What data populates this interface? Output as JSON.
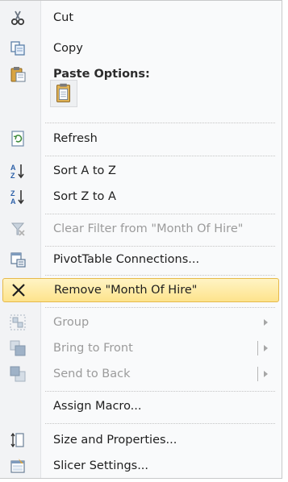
{
  "menu": {
    "cut": "Cut",
    "copy": "Copy",
    "paste_options": "Paste Options:",
    "refresh": "Refresh",
    "sort_az": "Sort A to Z",
    "sort_za": "Sort Z to A",
    "clear_filter": "Clear Filter from \"Month Of Hire\"",
    "pivot_connections": "PivotTable Connections...",
    "remove": "Remove \"Month Of Hire\"",
    "group": "Group",
    "bring_to_front": "Bring to Front",
    "send_to_back": "Send to Back",
    "assign_macro": "Assign Macro...",
    "size_properties": "Size and Properties...",
    "slicer_settings": "Slicer Settings..."
  },
  "colors": {
    "highlight_border": "#e6b94a",
    "highlight_fill": "#fde38c",
    "disabled_text": "#9b9b9b"
  }
}
